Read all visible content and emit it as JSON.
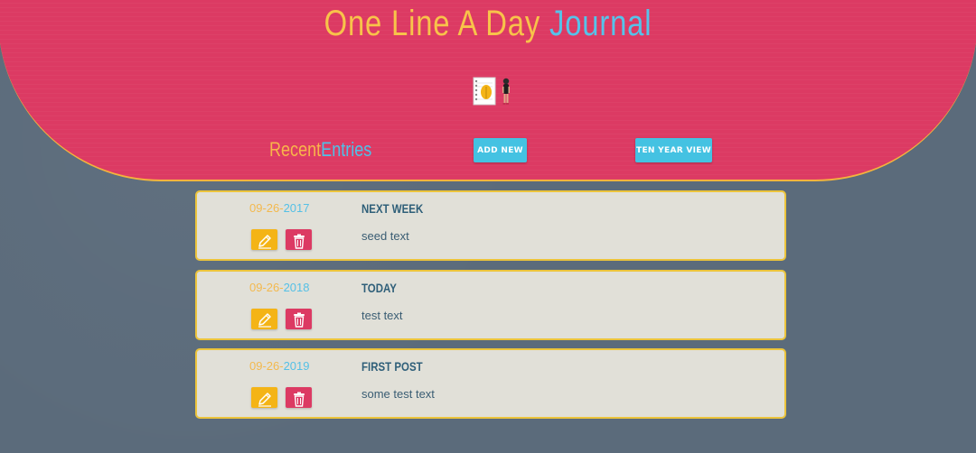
{
  "header": {
    "title_part1": "One Line A Day",
    "title_part2": "Journal"
  },
  "nav": {
    "recent_part1": "Recent",
    "recent_part2": "Entries",
    "add_new_label": "ADD NEW",
    "ten_year_label": "TEN YEAR VIEW"
  },
  "entries": [
    {
      "date_md": "09-26-",
      "date_y": "2017",
      "title": "Next Week",
      "text": "seed text"
    },
    {
      "date_md": "09-26-",
      "date_y": "2018",
      "title": "Today",
      "text": "test text"
    },
    {
      "date_md": "09-26-",
      "date_y": "2019",
      "title": "First Post",
      "text": "some test text"
    }
  ],
  "icons": {
    "logo": "journal-logo-icon",
    "edit": "pencil-icon",
    "delete": "trash-icon"
  },
  "colors": {
    "header_bg": "#dc3a63",
    "accent_yellow": "#f8c34a",
    "accent_blue": "#56c3ea",
    "card_bg": "#e1e0d8",
    "card_border": "#ecc43b",
    "page_bg": "#5b6b7b"
  }
}
